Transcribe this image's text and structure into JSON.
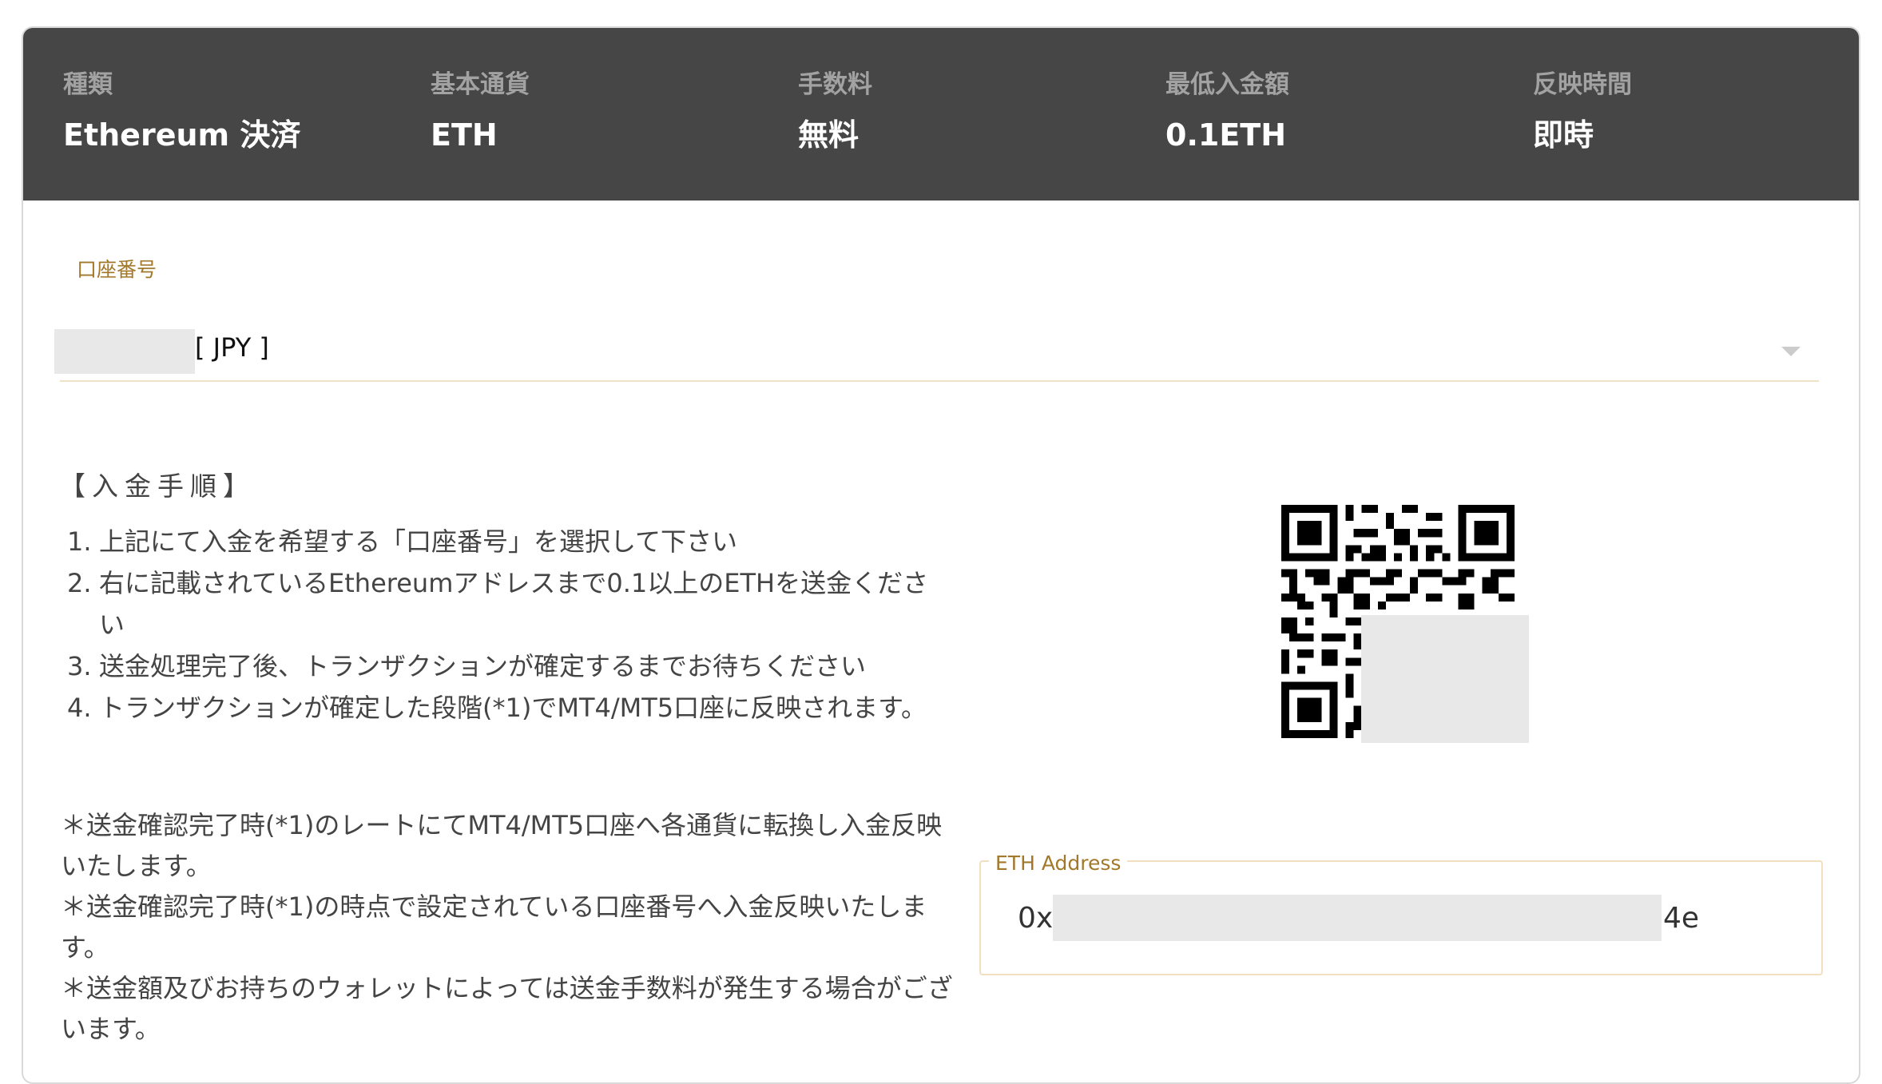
{
  "summary": {
    "columns": [
      {
        "label": "種類",
        "value": "Ethereum 決済"
      },
      {
        "label": "基本通貨",
        "value": "ETH"
      },
      {
        "label": "手数料",
        "value": "無料"
      },
      {
        "label": "最低入金額",
        "value": "0.1ETH"
      },
      {
        "label": "反映時間",
        "value": "即時"
      }
    ]
  },
  "account": {
    "label": "口座番号",
    "value": "[ JPY ]",
    "icon": "chevron-down-icon"
  },
  "instructions": {
    "title": "【入金手順】",
    "steps": [
      {
        "num": "1.",
        "text": "上記にて入金を希望する「口座番号」を選択して下さい"
      },
      {
        "num": "2.",
        "text": "右に記載されているEthereumアドレスまで0.1以上のETHを送金ください"
      },
      {
        "num": "3.",
        "text": "送金処理完了後、トランザクションが確定するまでお待ちください"
      },
      {
        "num": "4.",
        "text": "トランザクションが確定した段階(*1)でMT4/MT5口座に反映されます。"
      }
    ],
    "notes": [
      "＊送金確認完了時(*1)のレートにてMT4/MT5口座へ各通貨に転換し入金反映いたします。",
      "＊送金確認完了時(*1)の時点で設定されている口座番号へ入金反映いたします。",
      "＊送金額及びお持ちのウォレットによっては送金手数料が発生する場合がございます。"
    ]
  },
  "address": {
    "label": "ETH Address",
    "prefix": "0x",
    "suffix": "4e"
  },
  "colors": {
    "header_bg": "#464646",
    "accent": "#a2782a",
    "field_border": "#f2dfbf"
  }
}
